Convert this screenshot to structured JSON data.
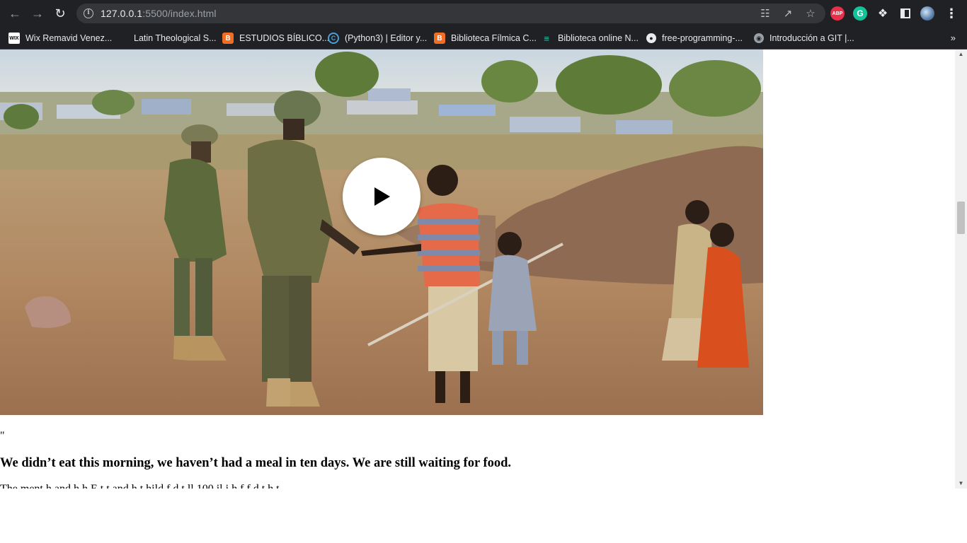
{
  "browser": {
    "url_host": "127.0.0.1",
    "url_rest": ":5500/index.html",
    "bookmarks": [
      {
        "label": "Wix Remavid Venez...",
        "icon": "wix-icon"
      },
      {
        "label": "Latin Theological S...",
        "icon": "page-icon"
      },
      {
        "label": "ESTUDIOS BÍBLICO...",
        "icon": "blogger-icon"
      },
      {
        "label": "(Python3) | Editor y...",
        "icon": "python-icon"
      },
      {
        "label": "Biblioteca Fílmica C...",
        "icon": "blogger-icon"
      },
      {
        "label": "Biblioteca online N...",
        "icon": "books-icon"
      },
      {
        "label": "free-programming-...",
        "icon": "github-icon"
      },
      {
        "label": "Introducción a GIT |...",
        "icon": "globe-icon"
      }
    ],
    "extensions": {
      "abp": "ABP",
      "grammarly": "G"
    }
  },
  "page": {
    "quote_mark": "\"",
    "headline": "We didn’t eat this morning, we haven’t had a meal in ten days. We are still waiting for food.",
    "body_partial": "The  ment  h  and    h          h   E  t   t   and  h       t         hild        f        d t      ll     100  il    i       h     f f  d       t          h      t"
  }
}
